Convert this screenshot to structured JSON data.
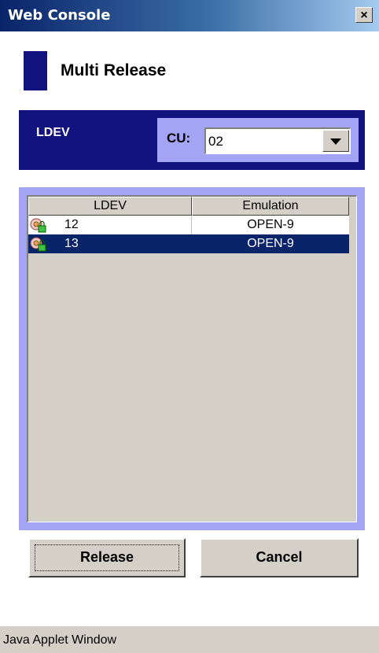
{
  "window": {
    "title": "Web Console",
    "close_label": "✕"
  },
  "page": {
    "heading": "Multi Release"
  },
  "cu_bar": {
    "ldev_label": "LDEV",
    "cu_label": "CU:",
    "cu_value": "02"
  },
  "table": {
    "columns": [
      "LDEV",
      "Emulation"
    ],
    "rows": [
      {
        "ldev": "12",
        "emulation": "OPEN-9",
        "selected": false
      },
      {
        "ldev": "13",
        "emulation": "OPEN-9",
        "selected": true
      }
    ]
  },
  "buttons": {
    "release": "Release",
    "cancel": "Cancel"
  },
  "status": {
    "text": "Java Applet Window"
  },
  "colors": {
    "title_bar": "#0a246a",
    "accent_navy": "#12127e",
    "accent_lavender": "#a4a4f4",
    "selection": "#0a246a",
    "panel_gray": "#d4d0c8"
  },
  "icons": {
    "ldev_row_icon": "disk-lock-icon",
    "dropdown": "chevron-down-icon",
    "close": "close-icon"
  }
}
